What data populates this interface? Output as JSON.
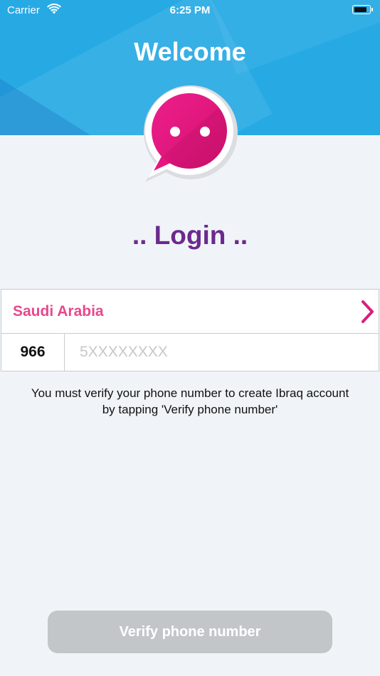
{
  "status_bar": {
    "carrier": "Carrier",
    "time": "6:25 PM",
    "icons": [
      "wifi-icon",
      "battery-icon"
    ]
  },
  "header": {
    "title": "Welcome",
    "background_color": "#27aae4"
  },
  "logo": {
    "icon": "chat-bubble-logo",
    "color": "#e6157f"
  },
  "login": {
    "title": ".. Login ..",
    "title_color": "#6b2a8e"
  },
  "country": {
    "name": "Saudi Arabia",
    "color": "#e8488c",
    "chevron_icon": "chevron-right-icon"
  },
  "phone": {
    "code": "966",
    "placeholder": "5XXXXXXXX",
    "value": ""
  },
  "note": {
    "text": "You must verify your phone number to create Ibraq account by tapping 'Verify phone number'"
  },
  "verify_button": {
    "label": "Verify phone number",
    "background_color": "#c3c6c9",
    "enabled": false
  }
}
